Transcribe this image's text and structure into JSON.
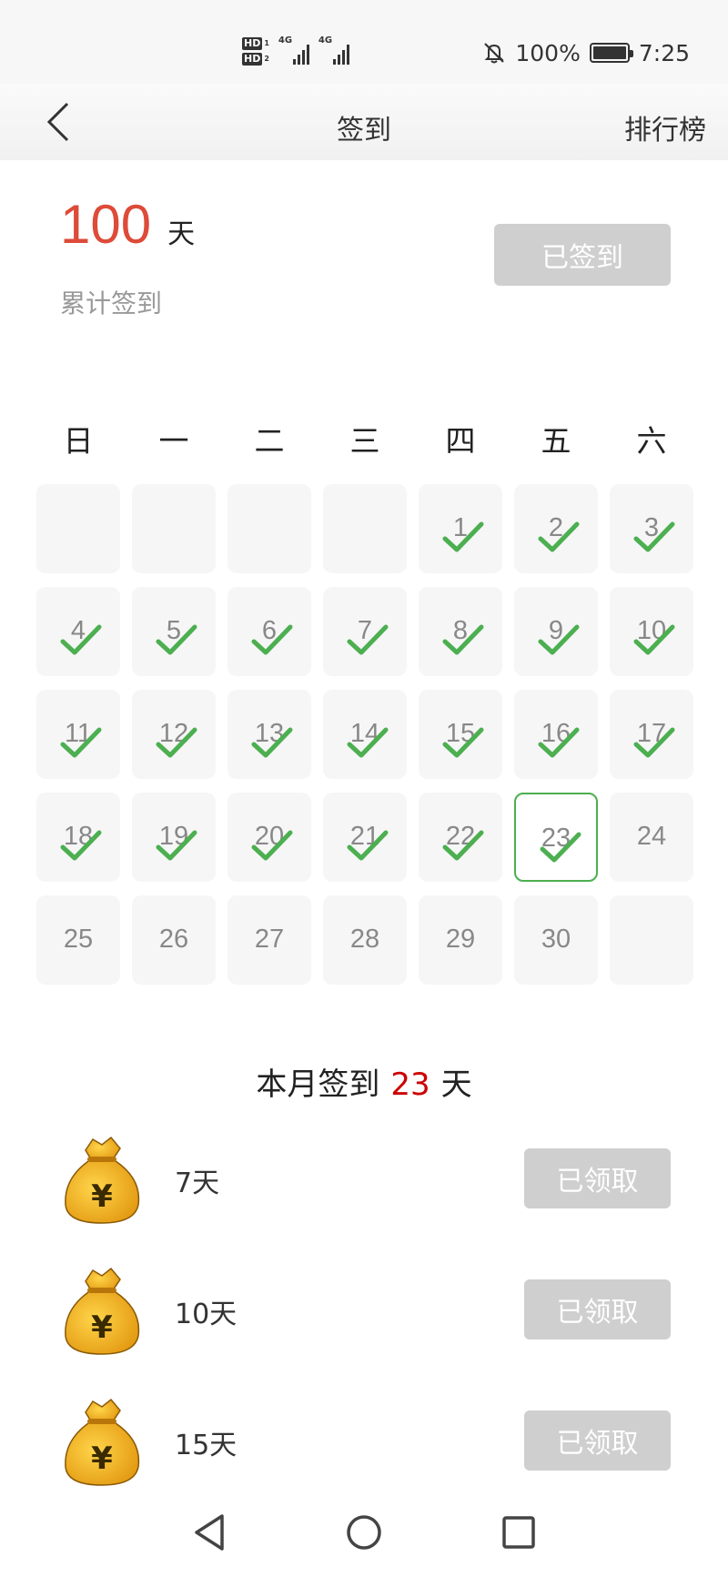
{
  "status_bar": {
    "hd1": "HD",
    "hd1_sub": "1",
    "hd2": "HD",
    "hd2_sub": "2",
    "net1": "4G",
    "net2": "4G",
    "battery": "100%",
    "time": "7:25"
  },
  "nav": {
    "title": "签到",
    "rank": "排行榜"
  },
  "summary": {
    "total_days": "100",
    "total_unit": "天",
    "total_label": "累计签到",
    "signed_button": "已签到"
  },
  "weekdays": [
    "日",
    "一",
    "二",
    "三",
    "四",
    "五",
    "六"
  ],
  "calendar": {
    "leading_blanks": 4,
    "days_in_month": 30,
    "checked_through": 23,
    "today": 23
  },
  "month_summary": {
    "prefix": "本月签到",
    "count": "23",
    "suffix": "天"
  },
  "rewards": [
    {
      "label": "7天",
      "button": "已领取"
    },
    {
      "label": "10天",
      "button": "已领取"
    },
    {
      "label": "15天",
      "button": "已领取"
    }
  ],
  "colors": {
    "accent_red": "#dd4b39",
    "check_green": "#4caf50",
    "disabled_gray": "#cfcfcf"
  }
}
